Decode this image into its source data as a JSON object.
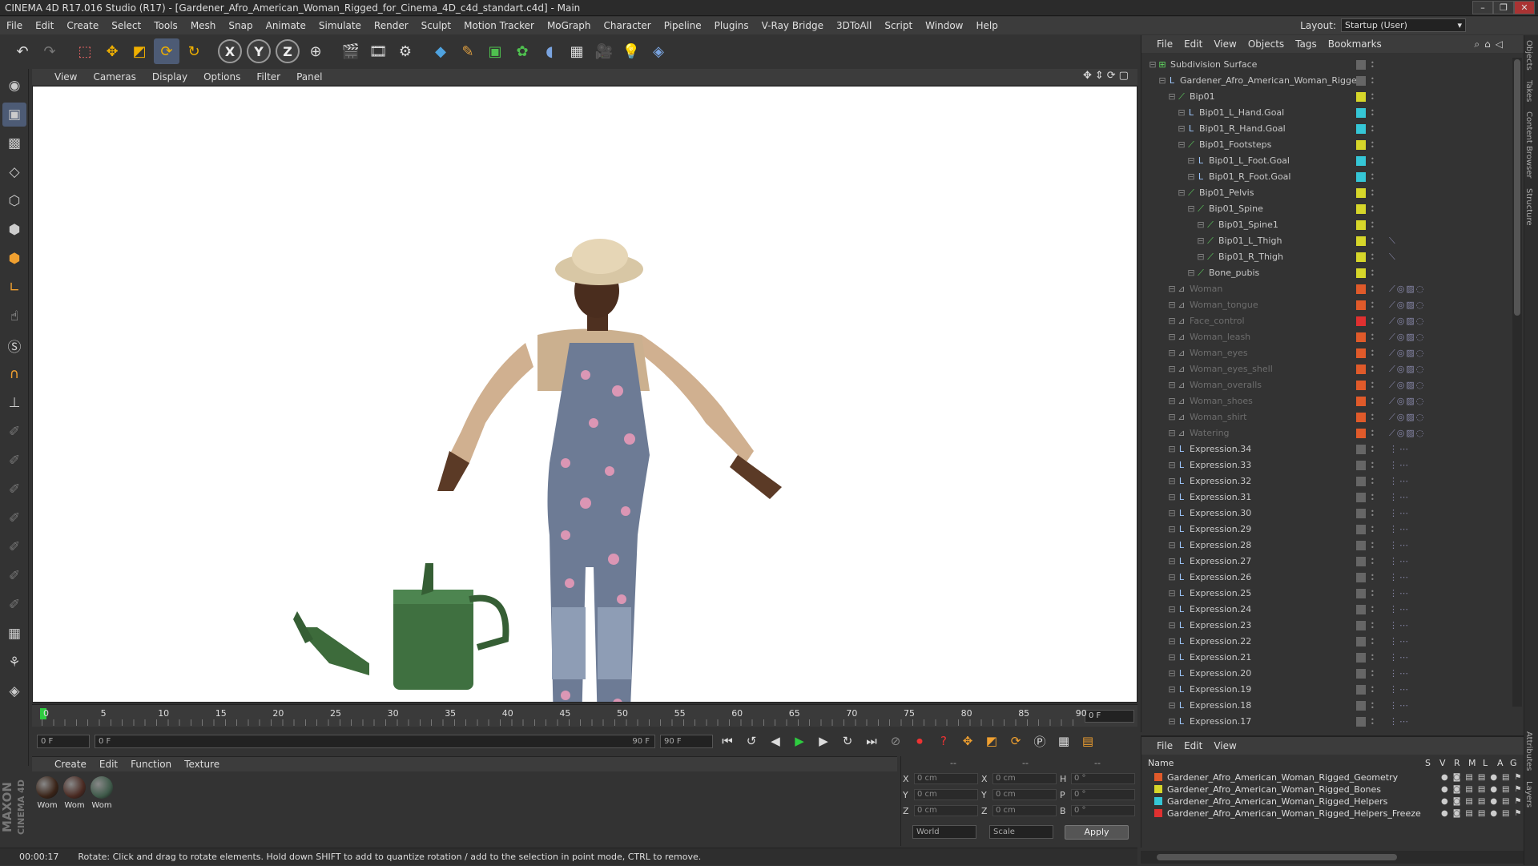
{
  "window": {
    "title": "CINEMA 4D R17.016 Studio (R17) - [Gardener_Afro_American_Woman_Rigged_for_Cinema_4D_c4d_standart.c4d] - Main",
    "controls": [
      "–",
      "❐",
      "✕"
    ]
  },
  "menubar": [
    "File",
    "Edit",
    "Create",
    "Select",
    "Tools",
    "Mesh",
    "Snap",
    "Animate",
    "Simulate",
    "Render",
    "Sculpt",
    "Motion Tracker",
    "MoGraph",
    "Character",
    "Pipeline",
    "Plugins",
    "V-Ray Bridge",
    "3DToAll",
    "Script",
    "Window",
    "Help"
  ],
  "layout": {
    "label": "Layout:",
    "value": "Startup (User)"
  },
  "toolbar_icons": [
    "undo-icon",
    "redo-icon",
    "live-select-icon",
    "move-icon",
    "scale-icon",
    "rotate-icon",
    "recent-icon",
    "x-axis-icon",
    "y-axis-icon",
    "z-axis-icon",
    "world-coord-icon",
    "render-view-icon",
    "render-picture-viewer-icon",
    "render-settings-icon",
    "cube-icon",
    "pen-icon",
    "subdivision-icon",
    "cloner-icon",
    "deformer-icon",
    "floor-icon",
    "camera-icon",
    "light-icon",
    "python-icon"
  ],
  "axis_labels": {
    "x": "X",
    "y": "Y",
    "z": "Z"
  },
  "viewport": {
    "menu": [
      "View",
      "Cameras",
      "Display",
      "Options",
      "Filter",
      "Panel"
    ]
  },
  "timeline": {
    "ticks": [
      "0",
      "5",
      "10",
      "15",
      "20",
      "25",
      "30",
      "35",
      "40",
      "45",
      "50",
      "55",
      "60",
      "65",
      "70",
      "75",
      "80",
      "85",
      "90"
    ],
    "current_frame": "0 F",
    "start": "0 F",
    "range_start": "0 F",
    "range_end": "90 F",
    "end": "90 F"
  },
  "materials": {
    "menu": [
      "Create",
      "Edit",
      "Function",
      "Texture"
    ],
    "items": [
      {
        "label": "Wom",
        "color": "#3a2418"
      },
      {
        "label": "Wom",
        "color": "#4a2a22"
      },
      {
        "label": "Wom",
        "color": "#3f5a4a"
      }
    ]
  },
  "coords": {
    "headers": [
      "--",
      "--",
      "--"
    ],
    "rows": [
      {
        "a": "X",
        "av": "0 cm",
        "b": "X",
        "bv": "0 cm",
        "c": "H",
        "cv": "0 °"
      },
      {
        "a": "Y",
        "av": "0 cm",
        "b": "Y",
        "bv": "0 cm",
        "c": "P",
        "cv": "0 °"
      },
      {
        "a": "Z",
        "av": "0 cm",
        "b": "Z",
        "bv": "0 cm",
        "c": "B",
        "cv": "0 °"
      }
    ],
    "mode1": "World",
    "mode2": "Scale",
    "apply": "Apply"
  },
  "status": {
    "time": "00:00:17",
    "message": "Rotate: Click and drag to rotate elements. Hold down SHIFT to add to quantize rotation / add to the selection in point mode, CTRL to remove."
  },
  "logo": {
    "line1": "MAXON",
    "line2": "CINEMA 4D"
  },
  "object_manager": {
    "menu": [
      "File",
      "Edit",
      "View",
      "Objects",
      "Tags",
      "Bookmarks"
    ],
    "rows": [
      {
        "name": "Subdivision Surface",
        "indent": 0,
        "dim": false,
        "layer": "",
        "icon": "⊞"
      },
      {
        "name": "Gardener_Afro_American_Woman_Rigged",
        "indent": 1,
        "dim": false,
        "layer": "",
        "icon": "L"
      },
      {
        "name": "Bip01",
        "indent": 2,
        "dim": false,
        "layer": "#d6d62a",
        "icon": "⟋"
      },
      {
        "name": "Bip01_L_Hand.Goal",
        "indent": 3,
        "dim": false,
        "layer": "#35c6d6",
        "icon": "L"
      },
      {
        "name": "Bip01_R_Hand.Goal",
        "indent": 3,
        "dim": false,
        "layer": "#35c6d6",
        "icon": "L"
      },
      {
        "name": "Bip01_Footsteps",
        "indent": 3,
        "dim": false,
        "layer": "#d6d62a",
        "icon": "⟋"
      },
      {
        "name": "Bip01_L_Foot.Goal",
        "indent": 4,
        "dim": false,
        "layer": "#35c6d6",
        "icon": "L"
      },
      {
        "name": "Bip01_R_Foot.Goal",
        "indent": 4,
        "dim": false,
        "layer": "#35c6d6",
        "icon": "L"
      },
      {
        "name": "Bip01_Pelvis",
        "indent": 3,
        "dim": false,
        "layer": "#d6d62a",
        "icon": "⟋"
      },
      {
        "name": "Bip01_Spine",
        "indent": 4,
        "dim": false,
        "layer": "#d6d62a",
        "icon": "⟋"
      },
      {
        "name": "Bip01_Spine1",
        "indent": 5,
        "dim": false,
        "layer": "#d6d62a",
        "icon": "⟋"
      },
      {
        "name": "Bip01_L_Thigh",
        "indent": 5,
        "dim": false,
        "layer": "#d6d62a",
        "icon": "⟋"
      },
      {
        "name": "Bip01_R_Thigh",
        "indent": 5,
        "dim": false,
        "layer": "#d6d62a",
        "icon": "⟋"
      },
      {
        "name": "Bone_pubis",
        "indent": 4,
        "dim": false,
        "layer": "#d6d62a",
        "icon": "⟋"
      },
      {
        "name": "Woman",
        "indent": 2,
        "dim": true,
        "layer": "#e05a2a",
        "icon": "⊿"
      },
      {
        "name": "Woman_tongue",
        "indent": 2,
        "dim": true,
        "layer": "#e05a2a",
        "icon": "⊿"
      },
      {
        "name": "Face_control",
        "indent": 2,
        "dim": true,
        "layer": "#e03030",
        "icon": "⊿"
      },
      {
        "name": "Woman_leash",
        "indent": 2,
        "dim": true,
        "layer": "#e05a2a",
        "icon": "⊿"
      },
      {
        "name": "Woman_eyes",
        "indent": 2,
        "dim": true,
        "layer": "#e05a2a",
        "icon": "⊿"
      },
      {
        "name": "Woman_eyes_shell",
        "indent": 2,
        "dim": true,
        "layer": "#e05a2a",
        "icon": "⊿"
      },
      {
        "name": "Woman_overalls",
        "indent": 2,
        "dim": true,
        "layer": "#e05a2a",
        "icon": "⊿"
      },
      {
        "name": "Woman_shoes",
        "indent": 2,
        "dim": true,
        "layer": "#e05a2a",
        "icon": "⊿"
      },
      {
        "name": "Woman_shirt",
        "indent": 2,
        "dim": true,
        "layer": "#e05a2a",
        "icon": "⊿"
      },
      {
        "name": "Watering",
        "indent": 2,
        "dim": true,
        "layer": "#e05a2a",
        "icon": "⊿"
      },
      {
        "name": "Expression.34",
        "indent": 2,
        "dim": false,
        "layer": "",
        "icon": "L"
      },
      {
        "name": "Expression.33",
        "indent": 2,
        "dim": false,
        "layer": "",
        "icon": "L"
      },
      {
        "name": "Expression.32",
        "indent": 2,
        "dim": false,
        "layer": "",
        "icon": "L"
      },
      {
        "name": "Expression.31",
        "indent": 2,
        "dim": false,
        "layer": "",
        "icon": "L"
      },
      {
        "name": "Expression.30",
        "indent": 2,
        "dim": false,
        "layer": "",
        "icon": "L"
      },
      {
        "name": "Expression.29",
        "indent": 2,
        "dim": false,
        "layer": "",
        "icon": "L"
      },
      {
        "name": "Expression.28",
        "indent": 2,
        "dim": false,
        "layer": "",
        "icon": "L"
      },
      {
        "name": "Expression.27",
        "indent": 2,
        "dim": false,
        "layer": "",
        "icon": "L"
      },
      {
        "name": "Expression.26",
        "indent": 2,
        "dim": false,
        "layer": "",
        "icon": "L"
      },
      {
        "name": "Expression.25",
        "indent": 2,
        "dim": false,
        "layer": "",
        "icon": "L"
      },
      {
        "name": "Expression.24",
        "indent": 2,
        "dim": false,
        "layer": "",
        "icon": "L"
      },
      {
        "name": "Expression.23",
        "indent": 2,
        "dim": false,
        "layer": "",
        "icon": "L"
      },
      {
        "name": "Expression.22",
        "indent": 2,
        "dim": false,
        "layer": "",
        "icon": "L"
      },
      {
        "name": "Expression.21",
        "indent": 2,
        "dim": false,
        "layer": "",
        "icon": "L"
      },
      {
        "name": "Expression.20",
        "indent": 2,
        "dim": false,
        "layer": "",
        "icon": "L"
      },
      {
        "name": "Expression.19",
        "indent": 2,
        "dim": false,
        "layer": "",
        "icon": "L"
      },
      {
        "name": "Expression.18",
        "indent": 2,
        "dim": false,
        "layer": "",
        "icon": "L"
      },
      {
        "name": "Expression.17",
        "indent": 2,
        "dim": false,
        "layer": "",
        "icon": "L"
      }
    ]
  },
  "layer_manager": {
    "menu": [
      "File",
      "Edit",
      "View"
    ],
    "headers": {
      "name": "Name",
      "s": "S",
      "v": "V",
      "r": "R",
      "m": "M",
      "l": "L",
      "a": "A",
      "g": "G"
    },
    "layers": [
      {
        "name": "Gardener_Afro_American_Woman_Rigged_Geometry",
        "color": "#e05a2a"
      },
      {
        "name": "Gardener_Afro_American_Woman_Rigged_Bones",
        "color": "#d6d62a"
      },
      {
        "name": "Gardener_Afro_American_Woman_Rigged_Helpers",
        "color": "#35c6d6"
      },
      {
        "name": "Gardener_Afro_American_Woman_Rigged_Helpers_Freeze",
        "color": "#e03030"
      }
    ]
  },
  "right_tabs": [
    "Objects",
    "Takes",
    "Content Browser",
    "Structure",
    "Attributes",
    "Layers"
  ]
}
